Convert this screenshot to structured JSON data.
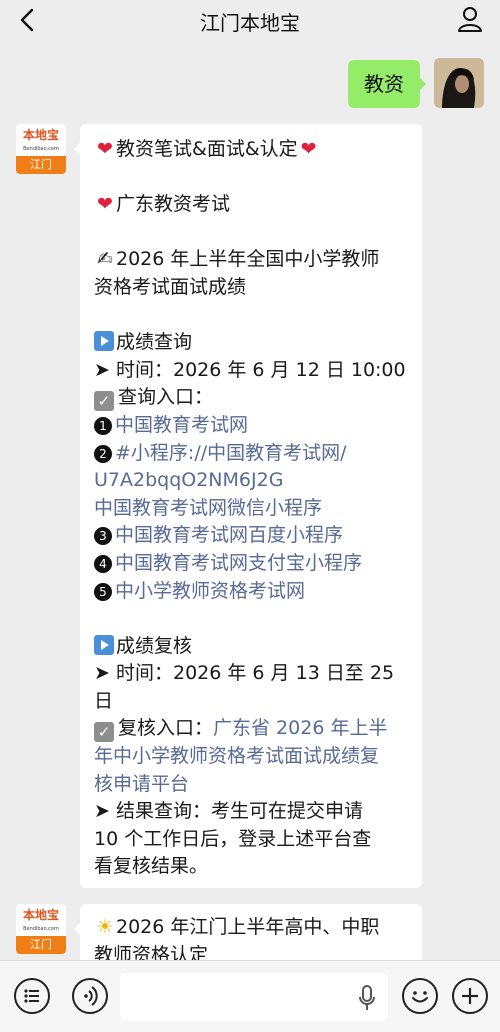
{
  "header": {
    "title": "江门本地宝"
  },
  "user_message": {
    "text": "教资"
  },
  "brand_avatar": {
    "top": "本地宝",
    "sub": "Bendibao.com",
    "bottom": "江门"
  },
  "reply": {
    "lines": [
      "教资笔试&面试&认定",
      "广东教资考试",
      "2026 年上半年全国中小学教师",
      "资格考试面试成绩",
      "成绩查询",
      "时间：2026 年 6 月 12 日 10:00",
      "查询入口：",
      "中国教育考试网",
      "#小程序://中国教育考试网/",
      "U7A2bqqO2NM6J2G",
      "中国教育考试网微信小程序",
      "中国教育考试网百度小程序",
      "中国教育考试网支付宝小程序",
      "中小学教师资格考试网",
      "成绩复核",
      "时间：2026 年 6 月 13 日至 25",
      "日",
      "复核入口：",
      "广东省 2026 年上半",
      "年中小学教师资格考试面试成绩复",
      "核申请平台",
      "结果查询：考生可在提交申请",
      "10 个工作日后，登录上述平台查",
      "看复核结果。"
    ],
    "num_badges": [
      "1",
      "2",
      "3",
      "4",
      "5"
    ]
  },
  "reply2": {
    "lines": [
      "2026 年江门上半年高中、中职",
      "教师资格认定"
    ]
  },
  "colors": {
    "bubble_out": "#95ec69",
    "link": "#576b95",
    "brand_orange": "#f07d16"
  }
}
